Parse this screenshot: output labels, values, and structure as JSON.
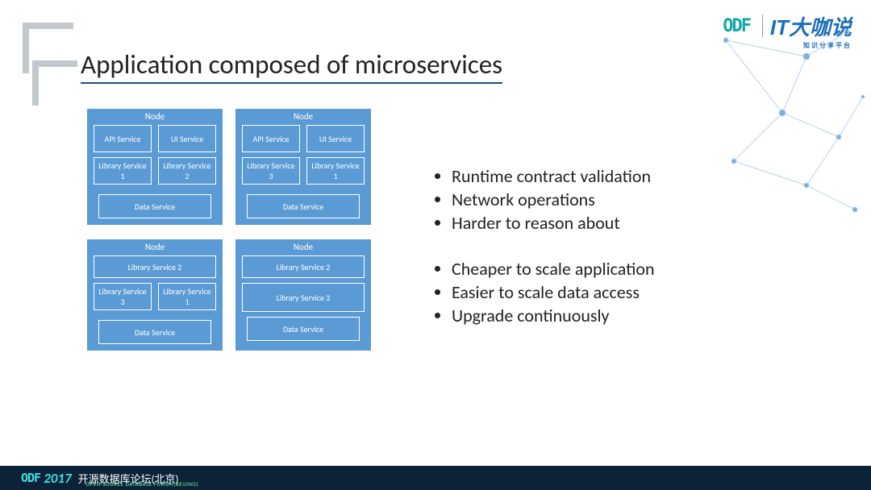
{
  "title": "Application composed of microservices",
  "logos": {
    "odf": "ODF",
    "it": "IT大咖说",
    "it_sub": "知识分享平台"
  },
  "nodes": {
    "header": "Node",
    "top_left": {
      "row1": [
        "API Service",
        "UI Service"
      ],
      "row2": [
        "Library Service 1",
        "Library Service 2"
      ],
      "data": "Data Service"
    },
    "top_right": {
      "row1": [
        "API Service",
        "UI Service"
      ],
      "row2": [
        "Library Service 3",
        "Library Service 1"
      ],
      "data": "Data Service"
    },
    "bot_left": {
      "wide1": "Library Service 2",
      "row": [
        "Library Service 3",
        "Library Service 1"
      ],
      "data": "Data Service"
    },
    "bot_right": {
      "wide1": "Library Service 2",
      "wide2": "Library Service 3",
      "data": "Data Service"
    }
  },
  "bullets_a": [
    "Runtime contract validation",
    "Network operations",
    "Harder to reason about"
  ],
  "bullets_b": [
    "Cheaper to scale application",
    "Easier to scale data access",
    "Upgrade continuously"
  ],
  "footer": {
    "odf": "ODF",
    "year": "2017",
    "cn": "开源数据库论坛(北京)",
    "sub": "OPEN-SOURCE DATABASE FORUM(BEIJING)"
  }
}
